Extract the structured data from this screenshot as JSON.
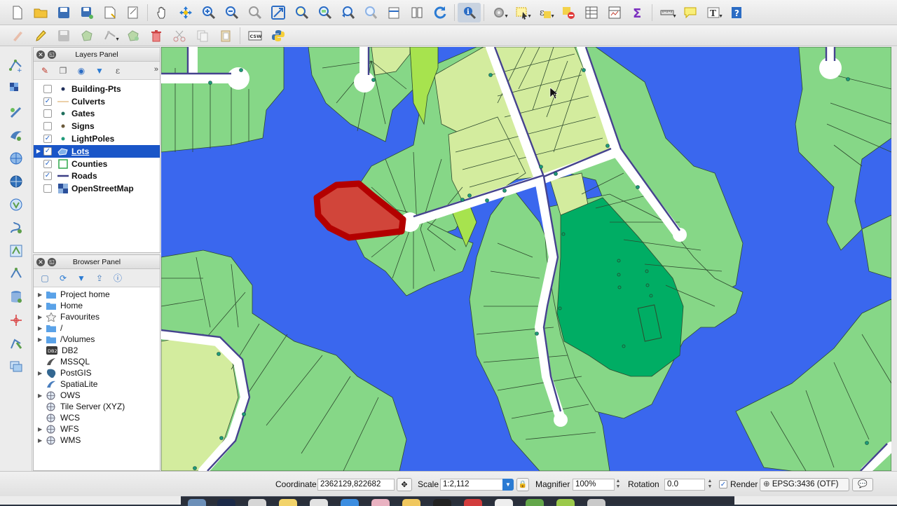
{
  "layers_panel": {
    "title": "Layers Panel",
    "layers": [
      {
        "name": "Building-Pts",
        "checked": false,
        "symbol": "dot",
        "color": "#1f2f5a"
      },
      {
        "name": "Culverts",
        "checked": true,
        "symbol": "line",
        "color": "#e0b070"
      },
      {
        "name": "Gates",
        "checked": false,
        "symbol": "dot",
        "color": "#1e6e5c"
      },
      {
        "name": "Signs",
        "checked": false,
        "symbol": "dot",
        "color": "#6b5a3a"
      },
      {
        "name": "LightPoles",
        "checked": true,
        "symbol": "dot",
        "color": "#1f9a7a"
      },
      {
        "name": "Lots",
        "checked": true,
        "symbol": "poly-icon",
        "color": "#7fb0e8",
        "selected": true,
        "expandable": true
      },
      {
        "name": "Counties",
        "checked": true,
        "symbol": "square",
        "color": "#2ea84a"
      },
      {
        "name": "Roads",
        "checked": true,
        "symbol": "line",
        "color": "#3b3f86"
      },
      {
        "name": "OpenStreetMap",
        "checked": false,
        "symbol": "raster",
        "color": "#2a4f9a"
      }
    ]
  },
  "browser_panel": {
    "title": "Browser Panel",
    "items": [
      {
        "label": "Project home",
        "icon": "folder",
        "expandable": true
      },
      {
        "label": "Home",
        "icon": "folder",
        "expandable": true
      },
      {
        "label": "Favourites",
        "icon": "star",
        "expandable": true
      },
      {
        "label": "/",
        "icon": "folder",
        "expandable": true
      },
      {
        "label": "/Volumes",
        "icon": "folder",
        "expandable": true
      },
      {
        "label": "DB2",
        "icon": "db2",
        "expandable": false
      },
      {
        "label": "MSSQL",
        "icon": "mssql",
        "expandable": false
      },
      {
        "label": "PostGIS",
        "icon": "postgis",
        "expandable": true
      },
      {
        "label": "SpatiaLite",
        "icon": "spatialite",
        "expandable": false
      },
      {
        "label": "OWS",
        "icon": "globe",
        "expandable": true
      },
      {
        "label": "Tile Server (XYZ)",
        "icon": "globe",
        "expandable": false
      },
      {
        "label": "WCS",
        "icon": "globe",
        "expandable": false
      },
      {
        "label": "WFS",
        "icon": "globe",
        "expandable": true
      },
      {
        "label": "WMS",
        "icon": "globe",
        "expandable": true
      }
    ]
  },
  "toolbar2": {
    "csw_label": "CSW"
  },
  "statusbar": {
    "coordinate_label": "Coordinate",
    "coordinate_value": "2362129,822682",
    "scale_label": "Scale",
    "scale_value": "1:2,112",
    "magnifier_label": "Magnifier",
    "magnifier_value": "100%",
    "rotation_label": "Rotation",
    "rotation_value": "0.0",
    "render_label": "Render",
    "render_checked": true,
    "crs_label": "EPSG:3436 (OTF)"
  },
  "colors": {
    "water": "#3a67ee",
    "lot": "#86d787",
    "lot_light": "#d3ec9e",
    "park": "#00ad64",
    "road": "#ffffff",
    "road_line": "#45438e",
    "selected_fill": "#d1453a",
    "selected_outline": "#b30000",
    "accent": "#1a56c8"
  }
}
